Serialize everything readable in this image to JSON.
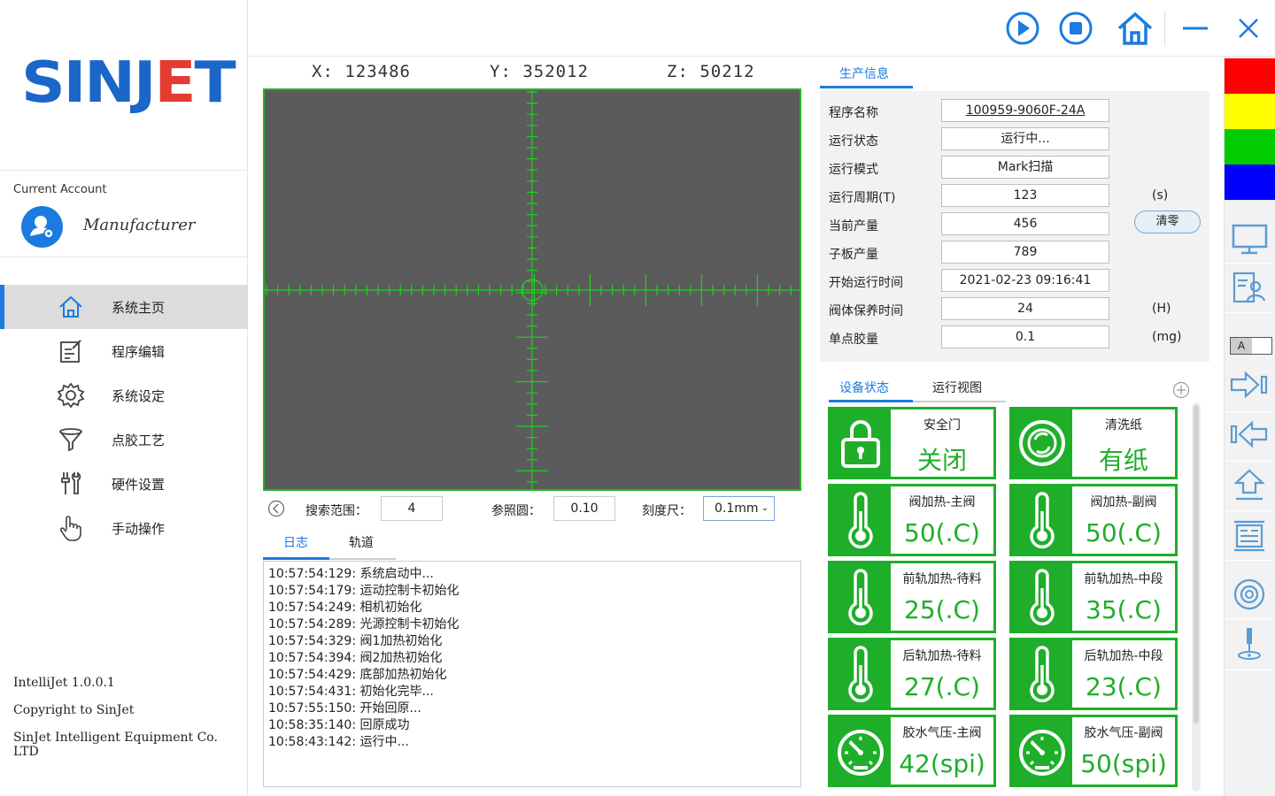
{
  "sidebar": {
    "logo": {
      "part1": "SINJ",
      "part2": "E",
      "part3": "T"
    },
    "account_label": "Current Account",
    "account_name": "Manufacturer",
    "items": [
      {
        "label": "系统主页",
        "icon": "home-icon"
      },
      {
        "label": "程序编辑",
        "icon": "edit-icon"
      },
      {
        "label": "系统设定",
        "icon": "gear-icon"
      },
      {
        "label": "点胶工艺",
        "icon": "funnel-icon"
      },
      {
        "label": "硬件设置",
        "icon": "tools-icon"
      },
      {
        "label": "手动操作",
        "icon": "hand-icon"
      }
    ],
    "footer": {
      "version": "IntelliJet 1.0.0.1",
      "copyright": "Copyright to SinJet",
      "company": "SinJet Intelligent Equipment Co. LTD"
    }
  },
  "topbar": {
    "buttons": [
      "play-icon",
      "stop-icon",
      "home-icon",
      "minimize-icon",
      "close-icon"
    ]
  },
  "coords": {
    "x": "X: 123486",
    "y": "Y: 352012",
    "z": "Z: 50212"
  },
  "camera": {
    "search_label": "搜索范围：",
    "search_value": "4",
    "ref_label": "参照圆：",
    "ref_value": "0.10",
    "scale_label": "刻度尺：",
    "scale_value": "0.1mm"
  },
  "bottom_tabs": {
    "log": "日志",
    "track": "轨道"
  },
  "log_lines": [
    "10:57:54:129: 系统启动中...",
    "10:57:54:179: 运动控制卡初始化",
    "10:57:54:249: 相机初始化",
    "10:57:54:289: 光源控制卡初始化",
    "10:57:54:329: 阀1加热初始化",
    "10:57:54:394: 阀2加热初始化",
    "10:57:54:429: 底部加热初始化",
    "10:57:54:431: 初始化完毕...",
    "10:57:55:150: 开始回原...",
    "10:58:35:140: 回原成功",
    "10:58:43:142: 运行中..."
  ],
  "production": {
    "tab": "生产信息",
    "rows": [
      {
        "label": "程序名称",
        "value": "100959-9060F-24A",
        "unit": ""
      },
      {
        "label": "运行状态",
        "value": "运行中...",
        "unit": ""
      },
      {
        "label": "运行模式",
        "value": "Mark扫描",
        "unit": ""
      },
      {
        "label": "运行周期(T)",
        "value": "123",
        "unit": "(s)"
      },
      {
        "label": "当前产量",
        "value": "456",
        "unit": ""
      },
      {
        "label": "子板产量",
        "value": "789",
        "unit": ""
      },
      {
        "label": "开始运行时间",
        "value": "2021-02-23 09:16:41",
        "unit": ""
      },
      {
        "label": "阀体保养时间",
        "value": "24",
        "unit": "(H)"
      },
      {
        "label": "单点胶量",
        "value": "0.1",
        "unit": "(mg)"
      }
    ],
    "clear_button": "清零"
  },
  "status_tabs": {
    "device": "设备状态",
    "view": "运行视图"
  },
  "cards": [
    {
      "title": "安全门",
      "value": "关闭",
      "icon": "lock-icon"
    },
    {
      "title": "清洗纸",
      "value": "有纸",
      "icon": "paper-roll-icon"
    },
    {
      "title": "阀加热-主阀",
      "value": "50(.C)",
      "icon": "thermometer-icon"
    },
    {
      "title": "阀加热-副阀",
      "value": "50(.C)",
      "icon": "thermometer-icon"
    },
    {
      "title": "前轨加热-待料",
      "value": "25(.C)",
      "icon": "thermometer-icon"
    },
    {
      "title": "前轨加热-中段",
      "value": "35(.C)",
      "icon": "thermometer-icon"
    },
    {
      "title": "后轨加热-待料",
      "value": "27(.C)",
      "icon": "thermometer-icon"
    },
    {
      "title": "后轨加热-中段",
      "value": "23(.C)",
      "icon": "thermometer-icon"
    },
    {
      "title": "胶水气压-主阀",
      "value": "42(spi)",
      "icon": "gauge-icon"
    },
    {
      "title": "胶水气压-副阀",
      "value": "50(spi)",
      "icon": "gauge-icon"
    }
  ],
  "colors": {
    "accent": "#1b7be0",
    "ok_green": "#1fae2a",
    "status_red": "#ff0000",
    "status_yellow": "#ffff00",
    "status_green": "#00cc00",
    "status_blue": "#0000ff"
  },
  "right_toolbar": {
    "toggle_label": "A"
  }
}
